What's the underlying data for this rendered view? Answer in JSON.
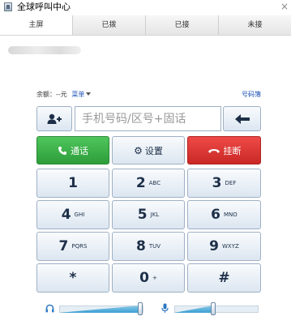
{
  "window": {
    "title": "全球呼叫中心"
  },
  "tabs": [
    {
      "label": "主屏",
      "active": true
    },
    {
      "label": "已拨",
      "active": false
    },
    {
      "label": "已接",
      "active": false
    },
    {
      "label": "未接",
      "active": false
    }
  ],
  "account": {
    "balance_label": "余额：--元",
    "menu_label": "菜单"
  },
  "phonebook_label": "号码簿",
  "dial_input": {
    "value": "",
    "placeholder": "手机号码/区号+固话"
  },
  "actions": {
    "call": "通话",
    "settings": "设置",
    "hangup": "挂断"
  },
  "keypad": [
    {
      "digit": "1",
      "letters": ""
    },
    {
      "digit": "2",
      "letters": "ABC"
    },
    {
      "digit": "3",
      "letters": "DEF"
    },
    {
      "digit": "4",
      "letters": "GHI"
    },
    {
      "digit": "5",
      "letters": "JKL"
    },
    {
      "digit": "6",
      "letters": "MNO"
    },
    {
      "digit": "7",
      "letters": "PQRS"
    },
    {
      "digit": "8",
      "letters": "TUV"
    },
    {
      "digit": "9",
      "letters": "WXYZ"
    },
    {
      "digit": "*",
      "letters": ""
    },
    {
      "digit": "0",
      "letters": "+"
    },
    {
      "digit": "#",
      "letters": ""
    }
  ],
  "volume": {
    "speaker_level": 1.0,
    "mic_level": 0.48
  },
  "icons": {
    "contact": "add-contact-icon",
    "back": "backspace-arrow-icon",
    "call": "phone-icon",
    "settings": "gear-icon",
    "hangup": "hangup-icon",
    "speaker": "headphones-icon",
    "mic": "microphone-icon"
  },
  "colors": {
    "call": "#3bb04a",
    "hangup": "#dc3432",
    "link": "#1a4fb5",
    "key_text": "#1d2f48"
  }
}
